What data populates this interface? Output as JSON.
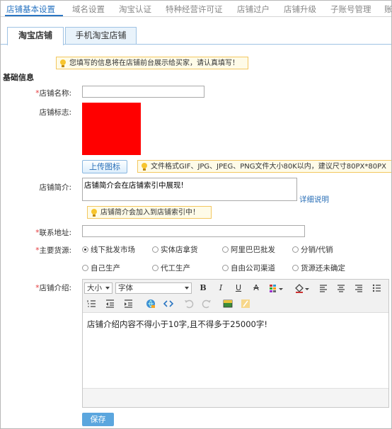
{
  "top_nav": [
    {
      "label": "店铺基本设置",
      "active": true
    },
    {
      "label": "域名设置"
    },
    {
      "label": "淘宝认证"
    },
    {
      "label": "特种经营许可证"
    },
    {
      "label": "店铺过户"
    },
    {
      "label": "店铺升级"
    },
    {
      "label": "子账号管理"
    },
    {
      "label": "账"
    }
  ],
  "sub_tabs": [
    "淘宝店铺",
    "手机淘宝店铺"
  ],
  "tips": {
    "top": "您填写的信息将在店铺前台展示给买家，请认真填写！",
    "logo": "文件格式GIF、JPG、JPEG、PNG文件大小80K以内，建议尺寸80PX*80PX",
    "intro": "店铺简介会加入到店铺索引中！"
  },
  "section_title": "基础信息",
  "form": {
    "required_mark": "*",
    "shop_name_label": "店铺名称:",
    "shop_name_value": "",
    "shop_logo_label": "店铺标志:",
    "upload_button": "上传图标",
    "shop_intro_label": "店铺简介:",
    "shop_intro_value": "店铺简介会在店铺索引中展现!",
    "detail_link": "详细说明",
    "address_label": "联系地址:",
    "address_value": "",
    "source_label": "主要货源:",
    "sources": [
      {
        "label": "线下批发市场",
        "checked": true
      },
      {
        "label": "实体店拿货",
        "checked": false
      },
      {
        "label": "阿里巴巴批发",
        "checked": false
      },
      {
        "label": "分销/代销",
        "checked": false
      },
      {
        "label": "自己生产",
        "checked": false
      },
      {
        "label": "代工生产",
        "checked": false
      },
      {
        "label": "自由公司渠道",
        "checked": false
      },
      {
        "label": "货源还未确定",
        "checked": false
      }
    ],
    "desc_label": "店铺介绍:",
    "editor": {
      "size_select": "大小",
      "font_select": "字体",
      "content": "店铺介绍内容不得小于10字,且不得多于25000字!"
    },
    "save_button": "保存"
  },
  "colors": {
    "accent": "#2a75c2",
    "logo_fill": "#ff0000",
    "required": "#e4393c",
    "save_bg": "#5ba6de"
  }
}
